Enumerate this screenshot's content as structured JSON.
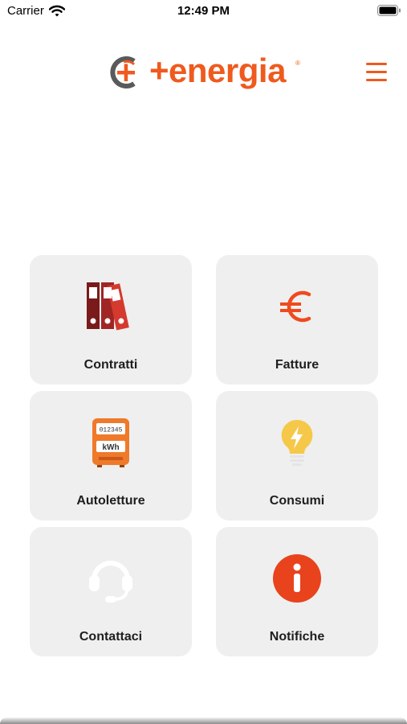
{
  "status_bar": {
    "carrier": "Carrier",
    "time": "12:49 PM"
  },
  "header": {
    "logo_text": "+energia",
    "logo_registered": "®",
    "brand_color": "#ef5a1e",
    "menu_icon": "hamburger-menu-icon"
  },
  "tiles": [
    {
      "label": "Contratti",
      "icon": "binders-icon"
    },
    {
      "label": "Fatture",
      "icon": "euro-icon"
    },
    {
      "label": "Autoletture",
      "icon": "electricity-meter-icon",
      "meter_digits": "012345",
      "meter_unit": "kWh"
    },
    {
      "label": "Consumi",
      "icon": "lightbulb-icon"
    },
    {
      "label": "Contattaci",
      "icon": "headset-icon"
    },
    {
      "label": "Notifiche",
      "icon": "info-icon"
    }
  ]
}
